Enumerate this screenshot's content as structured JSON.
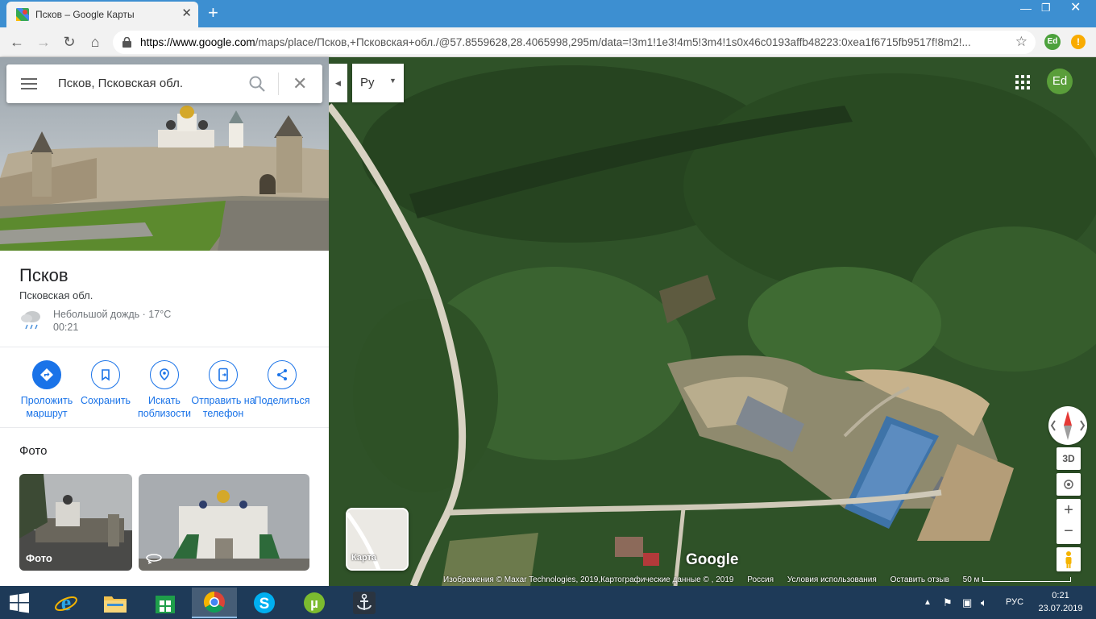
{
  "browser": {
    "tab_title": "Псков – Google Карты",
    "url_host": "https://www.google.com",
    "url_rest": "/maps/place/Псков,+Псковская+обл./@57.8559628,28.4065998,295m/data=!3m1!1e3!4m5!3m4!1s0x46c0193affb48223:0xea1f6715fb9517f!8m2!...",
    "profile_initials": "Ed"
  },
  "search": {
    "value": "Псков, Псковская обл."
  },
  "place": {
    "title": "Псков",
    "subtitle": "Псковская обл.",
    "weather": "Небольшой дождь · 17°C",
    "time": "00:21"
  },
  "actions": [
    {
      "label": "Проложить маршрут"
    },
    {
      "label": "Сохранить"
    },
    {
      "label": "Искать поблизости"
    },
    {
      "label": "Отправить на телефон"
    },
    {
      "label": "Поделиться"
    }
  ],
  "photos": {
    "title": "Фото",
    "first_label": "Фото"
  },
  "map": {
    "lang_label": "Ру",
    "avatar_initials": "Ed",
    "view_3d": "3D",
    "minimap_label": "Карта",
    "logo": "Google",
    "attribution": "Изображения © Maxar Technologies, 2019,Картографические данные © , 2019",
    "region": "Россия",
    "terms": "Условия использования",
    "feedback": "Оставить отзыв",
    "scale": "50 м"
  },
  "taskbar": {
    "lang": "РУС",
    "time": "0:21",
    "date": "23.07.2019"
  }
}
